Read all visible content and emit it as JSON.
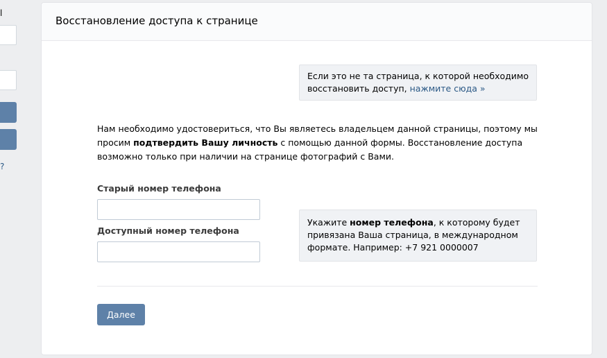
{
  "sidebar": {
    "label_fragment": "l",
    "link_fragment": "?"
  },
  "card": {
    "title": "Восстановление доступа к странице",
    "info_top": {
      "text": "Если это не та страница, к которой необходимо восстановить доступ, ",
      "link": "нажмите сюда »"
    },
    "intro": {
      "part1": "Нам необходимо удостовериться, что Вы являетесь владельцем данной страницы, поэтому мы просим ",
      "bold": "подтвердить Вашу личность",
      "part2": " с помощью данной формы. Восстановление доступа возможно только при наличии на странице фотографий с Вами."
    },
    "fields": {
      "old_phone_label": "Старый номер телефона",
      "old_phone_value": "",
      "new_phone_label": "Доступный номер телефона",
      "new_phone_value": ""
    },
    "info_phone": {
      "part1": "Укажите ",
      "bold": "номер телефона",
      "part2": ", к которому будет привязана Ваша страница, в международном формате. Например: +7 921 0000007"
    },
    "next_button": "Далее"
  },
  "colors": {
    "page_bg": "#edeef0",
    "button_bg": "#5e81a8",
    "link": "#2a5885",
    "info_bg": "#f0f2f5"
  }
}
